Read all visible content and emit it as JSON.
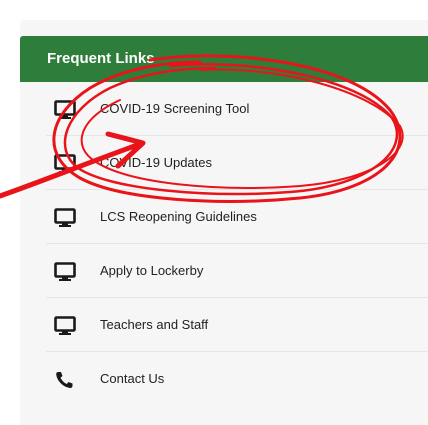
{
  "panel": {
    "title": "Frequent Links",
    "header_color": "#2f7d3a",
    "background_color": "#f6f6f6"
  },
  "links": [
    {
      "label": "COVID-19 Screening Tool",
      "icon": "monitor-icon"
    },
    {
      "label": "COVID-19 Updates",
      "icon": "monitor-icon"
    },
    {
      "label": "LCS Reopening Guidelines",
      "icon": "monitor-icon"
    },
    {
      "label": "Apply to Lockerby",
      "icon": "monitor-icon"
    },
    {
      "label": "Teachers and Staff",
      "icon": "monitor-icon"
    },
    {
      "label": "Contact Us",
      "icon": "phone-icon"
    }
  ],
  "annotation": {
    "color": "#e8141a",
    "shape": "scribbled-circle-and-arrow"
  }
}
